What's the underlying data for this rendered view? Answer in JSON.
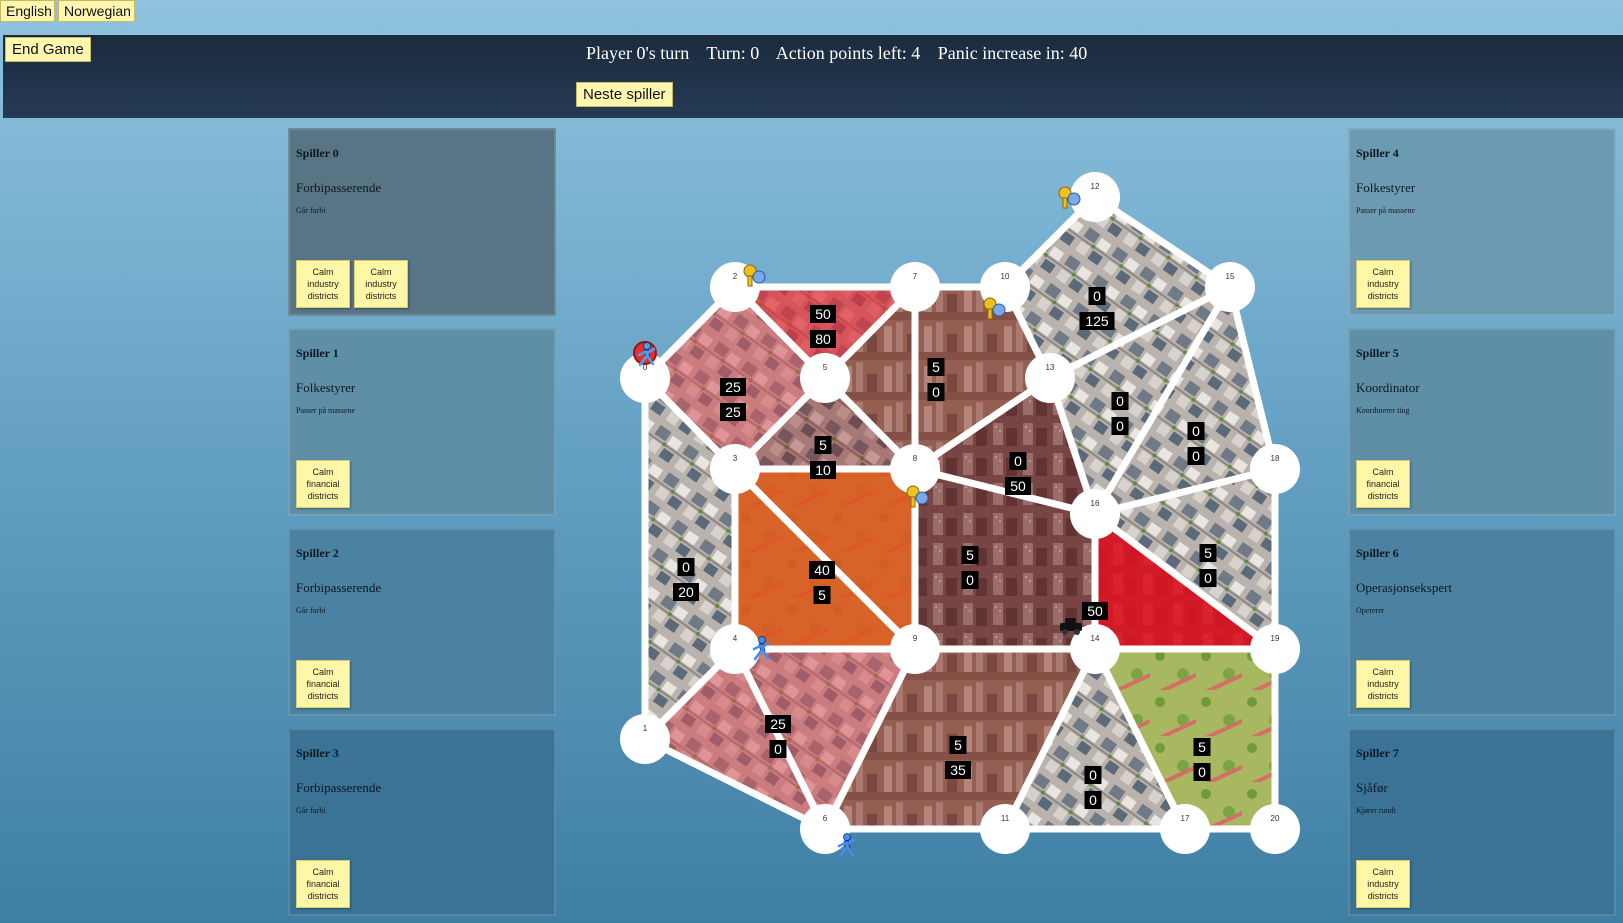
{
  "lang": {
    "english": "English",
    "norwegian": "Norwegian"
  },
  "header": {
    "end_game": "End Game",
    "turn_text": "Player 0's turn",
    "turn": "Turn: 0",
    "action_points": "Action points left: 4",
    "panic": "Panic increase in: 40",
    "next_player": "Neste spiller"
  },
  "players_left": [
    {
      "name": "Spiller 0",
      "role": "Forbipasserende",
      "desc": "Går forbi",
      "cards": [
        "Calm industry districts",
        "Calm industry districts"
      ]
    },
    {
      "name": "Spiller 1",
      "role": "Folkestyrer",
      "desc": "Passer på massene",
      "cards": [
        "Calm financial districts"
      ]
    },
    {
      "name": "Spiller 2",
      "role": "Forbipasserende",
      "desc": "Går forbi",
      "cards": [
        "Calm financial districts"
      ]
    },
    {
      "name": "Spiller 3",
      "role": "Forbipasserende",
      "desc": "Går forbi",
      "cards": [
        "Calm financial districts"
      ]
    }
  ],
  "players_right": [
    {
      "name": "Spiller 4",
      "role": "Folkestyrer",
      "desc": "Passer på massene",
      "cards": [
        "Calm industry districts"
      ]
    },
    {
      "name": "Spiller 5",
      "role": "Koordinator",
      "desc": "Koordinerer ting",
      "cards": [
        "Calm financial districts"
      ]
    },
    {
      "name": "Spiller 6",
      "role": "Operasjonsekspert",
      "desc": "Opererer",
      "cards": [
        "Calm industry districts"
      ]
    },
    {
      "name": "Spiller 7",
      "role": "Sjåfør",
      "desc": "Kjører rundt",
      "cards": [
        "Calm industry districts"
      ]
    }
  ],
  "map": {
    "nodes": [
      "0",
      "1",
      "2",
      "3",
      "4",
      "5",
      "6",
      "7",
      "8",
      "9",
      "10",
      "11",
      "12",
      "13",
      "14",
      "15",
      "16",
      "17",
      "18",
      "19",
      "20"
    ],
    "zones": [
      {
        "top": "50",
        "bottom": "80",
        "type": "residential",
        "panic": "high"
      },
      {
        "top": "25",
        "bottom": "25",
        "type": "residential",
        "panic": "medium"
      },
      {
        "top": "5",
        "bottom": "0",
        "type": "industry",
        "panic": "low"
      },
      {
        "top": "0",
        "bottom": "125",
        "type": "residential",
        "panic": "none"
      },
      {
        "top": "5",
        "bottom": "10",
        "type": "residential",
        "panic": "low"
      },
      {
        "top": "0",
        "bottom": "50",
        "type": "financial",
        "panic": "low"
      },
      {
        "top": "0",
        "bottom": "0",
        "type": "residential",
        "panic": "none"
      },
      {
        "top": "0",
        "bottom": "0",
        "type": "residential",
        "panic": "none"
      },
      {
        "top": "0",
        "bottom": "20",
        "type": "residential",
        "panic": "none"
      },
      {
        "top": "40",
        "bottom": "5",
        "type": "park",
        "panic": "high"
      },
      {
        "top": "5",
        "bottom": "0",
        "type": "financial",
        "panic": "low"
      },
      {
        "top": "50",
        "bottom": "",
        "type": "financial",
        "panic": "critical"
      },
      {
        "top": "5",
        "bottom": "0",
        "type": "residential",
        "panic": "none"
      },
      {
        "top": "25",
        "bottom": "0",
        "type": "residential",
        "panic": "medium"
      },
      {
        "top": "5",
        "bottom": "35",
        "type": "industry",
        "panic": "low"
      },
      {
        "top": "0",
        "bottom": "0",
        "type": "residential",
        "panic": "none"
      },
      {
        "top": "5",
        "bottom": "0",
        "type": "park",
        "panic": "none"
      }
    ],
    "colors": {
      "high": "#d9303a",
      "critical": "#e01020",
      "orange": "#e0541e",
      "medium": "#d9606a",
      "low": "#9a5050"
    },
    "tokens": [
      "player-0-icon",
      "player-icon",
      "player-icon",
      "player-icon",
      "player-icon",
      "player-icon",
      "player-icon",
      "car-icon"
    ]
  }
}
